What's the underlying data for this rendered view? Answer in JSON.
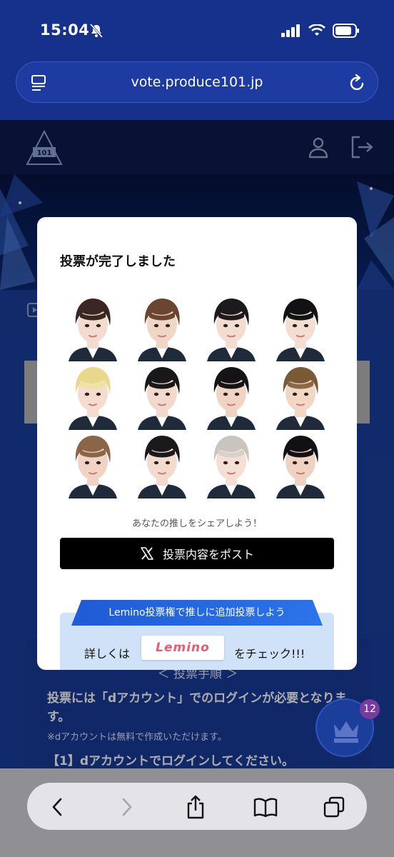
{
  "status": {
    "time": "15:04"
  },
  "browser": {
    "url": "vote.produce101.jp"
  },
  "site": {
    "logo_text": "PRODUCE 101"
  },
  "modal": {
    "title": "投票が完了しました",
    "share_prompt": "あなたの推しをシェアしよう！",
    "post_button": "投票内容をポスト",
    "lemino_ribbon": "Lemino投票権で推しに追加投票しよう",
    "lemino_detail": "詳しくは",
    "lemino_logo": "Lemino",
    "lemino_check": "をチェック!!!"
  },
  "trainees": [
    {
      "hair": "#3a2622",
      "face": "#f2dccf",
      "bang": "#3a2622"
    },
    {
      "hair": "#6b4530",
      "face": "#f0d6c4",
      "bang": "#6b4530"
    },
    {
      "hair": "#1c1a1c",
      "face": "#f3ddd0",
      "bang": "#1c1a1c"
    },
    {
      "hair": "#121214",
      "face": "#f4ded2",
      "bang": "#121214"
    },
    {
      "hair": "#e8d88a",
      "face": "#f5dccf",
      "bang": "#efe3a4"
    },
    {
      "hair": "#18171a",
      "face": "#f1d9cb",
      "bang": "#18171a"
    },
    {
      "hair": "#141316",
      "face": "#efd4c3",
      "bang": "#141316"
    },
    {
      "hair": "#7a5a36",
      "face": "#f2d7c5",
      "bang": "#8a6a44"
    },
    {
      "hair": "#8a6548",
      "face": "#f1d3c3",
      "bang": "#8a6548"
    },
    {
      "hair": "#1a191c",
      "face": "#f2dacd",
      "bang": "#1a191c"
    },
    {
      "hair": "#c9c4be",
      "face": "#f5ded3",
      "bang": "#d6d1cb"
    },
    {
      "hair": "#111013",
      "face": "#efd3c2",
      "bang": "#111013"
    }
  ],
  "background": {
    "info_heading": "＜ 投票手順 ＞",
    "info_text": "投票には「dアカウント」でのログインが必要となります。",
    "info_note": "※dアカウントは無料で作成いただけます。",
    "info_step": "【1】dアカウントでログインしてください。",
    "badge_count": "12"
  },
  "colors": {
    "primary": "#16318c",
    "accent": "#2b74ea",
    "badge": "#7b3aa0"
  }
}
